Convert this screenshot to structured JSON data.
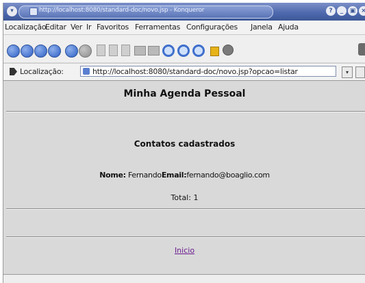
{
  "window": {
    "title": "http://localhost:8080/standard-doc/novo.jsp - Konqueror",
    "buttons": [
      "?",
      "_",
      "▣",
      "×"
    ]
  },
  "menu": [
    "Localização",
    "Editar",
    "Ver",
    "Ir",
    "Favoritos",
    "Ferramentas",
    "Configurações",
    "Janela",
    "Ajuda"
  ],
  "toolbar": {
    "icons": [
      "back-icon",
      "forward-icon",
      "up-icon",
      "home-icon",
      "reload-icon",
      "stop-icon",
      "cut-icon",
      "copy-icon",
      "paste-icon",
      "print-icon",
      "print-preview-icon",
      "find-icon",
      "zoom-in-icon",
      "zoom-out-icon",
      "security-lock-icon",
      "settings-icon"
    ]
  },
  "location": {
    "label": "Localização:",
    "url": "http://localhost:8080/standard-doc/novo.jsp?opcao=listar"
  },
  "page": {
    "title": "Minha Agenda Pessoal",
    "subtitle": "Contatos cadastrados",
    "contact": {
      "name_label": "Nome:",
      "name_value": "Fernando",
      "email_label": "Email:",
      "email_value": "fernando@boaglio.com"
    },
    "total": "Total: 1",
    "link": "Inicio"
  },
  "colors": {
    "titlebar": "#4f6aae",
    "content_bg": "#d9d9d9",
    "link": "#6a1b8f"
  }
}
